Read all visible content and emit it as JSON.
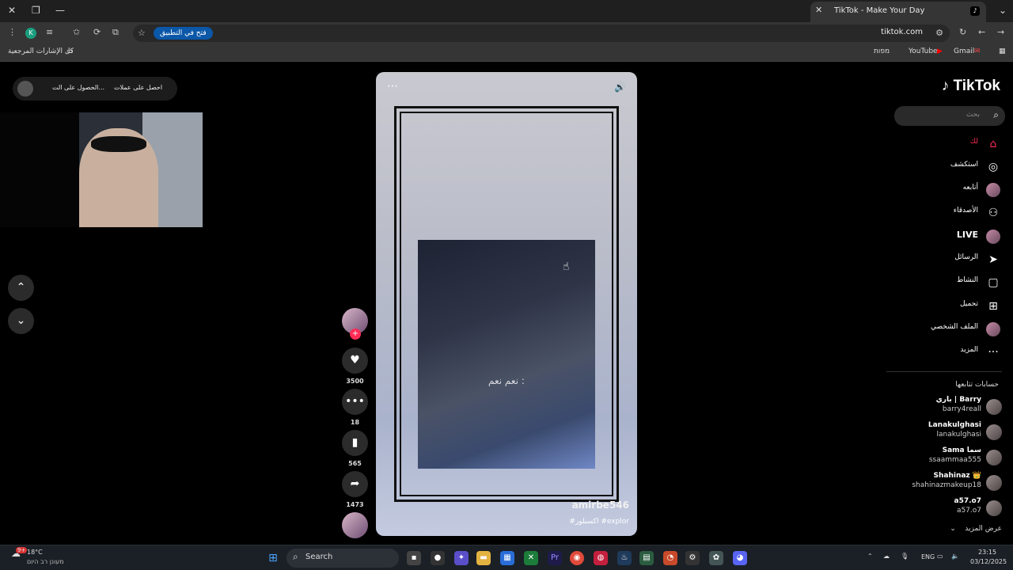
{
  "browser": {
    "tab_title": "TikTok - Make Your Day",
    "url": "tiktok.com",
    "open_app_label": "فتح في التطبيق",
    "profile_initial": "K",
    "bookmarks": {
      "all_bookmarks": "كل الإشارات المرجعية",
      "gmail": "Gmail",
      "youtube": "YouTube",
      "maps": "מפות"
    }
  },
  "page": {
    "promo": {
      "coins": "احصل على عملات",
      "app": "الحصول على الت..."
    },
    "video": {
      "caption": "نعم نعم :",
      "username": "amirbe546",
      "tags": "#اكسبلور #explor",
      "more": "⋯"
    },
    "actions": {
      "likes": "3500",
      "comments": "18",
      "saves": "565",
      "shares": "1473"
    }
  },
  "sidebar": {
    "logo": "TikTok",
    "search_placeholder": "بحث",
    "nav": [
      {
        "label": "لك",
        "icon": "home-icon"
      },
      {
        "label": "استكشف",
        "icon": "compass-icon"
      },
      {
        "label": "أتابعه",
        "icon": "avatar-icon"
      },
      {
        "label": "الأصدقاء",
        "icon": "friends-icon"
      },
      {
        "label": "LIVE",
        "icon": "live-icon"
      },
      {
        "label": "الرسائل",
        "icon": "send-icon"
      },
      {
        "label": "النشاط",
        "icon": "inbox-icon"
      },
      {
        "label": "تحميل",
        "icon": "plus-square-icon"
      },
      {
        "label": "الملف الشخصي",
        "icon": "profile-icon"
      },
      {
        "label": "المزيد",
        "icon": "more-icon"
      }
    ],
    "following_title": "حسابات تتابعها",
    "accounts": [
      {
        "name": "باري | Barry",
        "handle": "barry4reall"
      },
      {
        "name": "Lanakulghasi",
        "handle": "lanakulghasi"
      },
      {
        "name": "Sama سما",
        "handle": "ssaammaa555"
      },
      {
        "name": "Shahinaz 👑",
        "handle": "shahinazmakeup18"
      },
      {
        "name": "a57.o7",
        "handle": "a57.o7"
      }
    ],
    "see_more": "عرض المزيد"
  },
  "taskbar": {
    "weather_temp": "18°C",
    "weather_desc": "מעונן רב היום",
    "weather_badge": "9+",
    "search_label": "Search",
    "lang": "ENG",
    "time": "23:15",
    "date": "03/12/2025"
  }
}
